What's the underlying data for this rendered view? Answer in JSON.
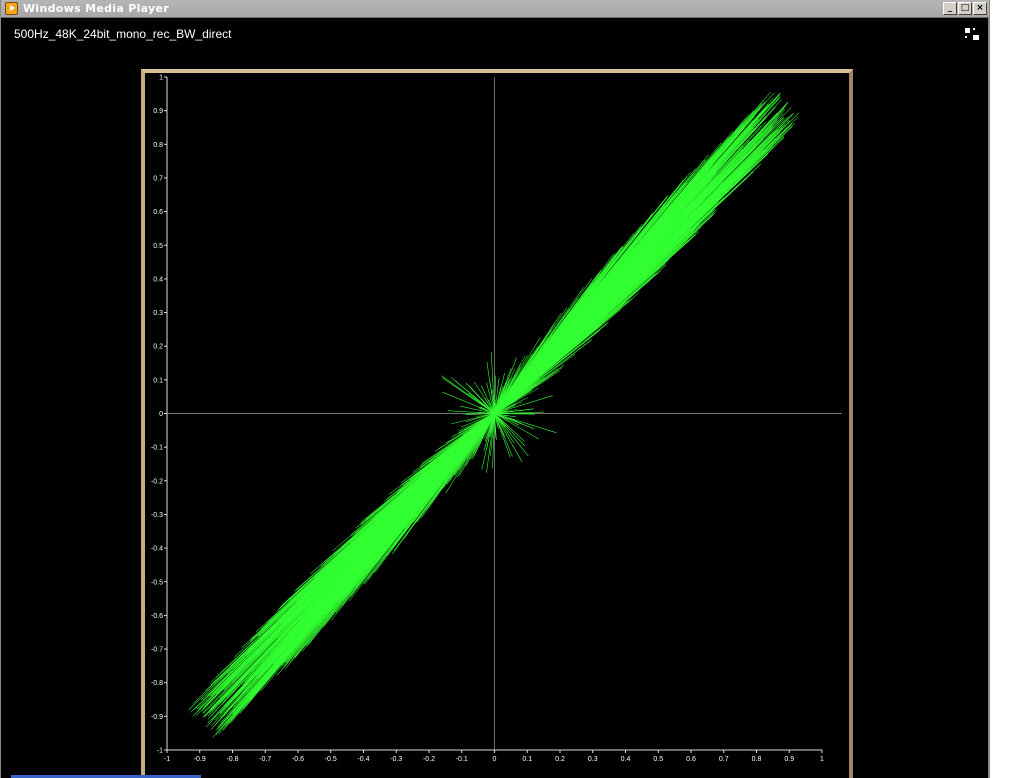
{
  "window": {
    "title": "Windows Media Player",
    "controls": {
      "minimize": "_",
      "maximize": "□",
      "close": "×"
    }
  },
  "media": {
    "title": "500Hz_48K_24bit_mono_rec_BW_direct"
  },
  "icons": {
    "app": "media-player-icon",
    "fullscreen": "fullscreen-toggle-icon"
  },
  "colors": {
    "trace": "#33ff33",
    "frame": "#c9ab80",
    "background": "#000000",
    "axis": "#9a9a9a"
  },
  "chart_data": {
    "type": "scatter",
    "xlim": [
      -1,
      1
    ],
    "ylim": [
      -1,
      1
    ],
    "x_ticks": [
      "-1",
      "-0.9",
      "-0.8",
      "-0.7",
      "-0.6",
      "-0.5",
      "-0.4",
      "-0.3",
      "-0.2",
      "-0.1",
      "0",
      "0.1",
      "0.2",
      "0.3",
      "0.4",
      "0.5",
      "0.6",
      "0.7",
      "0.8",
      "0.9",
      "1"
    ],
    "y_ticks": [
      "1",
      "0.9",
      "0.8",
      "0.7",
      "0.6",
      "0.5",
      "0.4",
      "0.3",
      "0.2",
      "0.1",
      "0",
      "-0.1",
      "-0.2",
      "-0.3",
      "-0.4",
      "-0.5",
      "-0.6",
      "-0.7",
      "-0.8",
      "-0.9",
      "-1"
    ],
    "series": [
      {
        "x": [
          -0.87,
          -0.6,
          -0.3,
          0,
          0.3,
          0.6,
          0.87
        ],
        "y": [
          -0.9,
          -0.62,
          -0.3,
          0,
          0.3,
          0.62,
          0.9
        ]
      }
    ],
    "grid": false
  }
}
